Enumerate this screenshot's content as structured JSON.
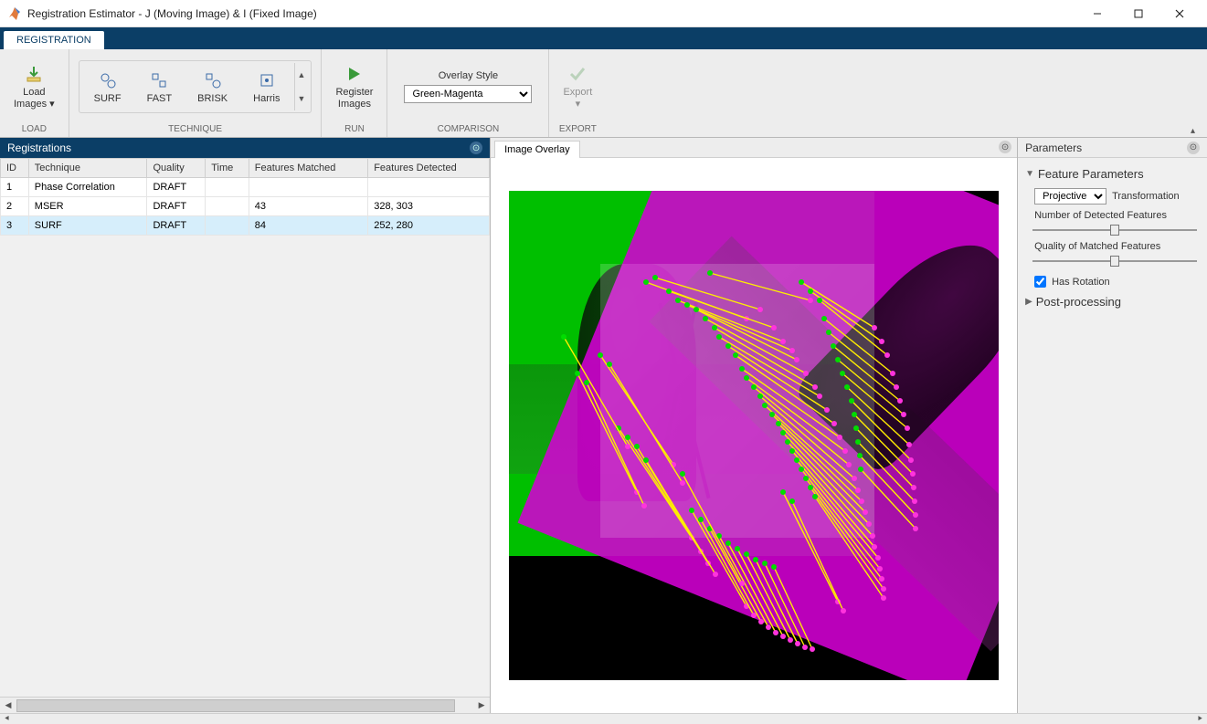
{
  "window": {
    "title": "Registration Estimator - J (Moving Image) & I (Fixed Image)"
  },
  "ribbon_tab": "REGISTRATION",
  "toolstrip": {
    "load": {
      "label": "Load\nImages",
      "group": "LOAD"
    },
    "technique": {
      "group": "TECHNIQUE",
      "items": [
        "SURF",
        "FAST",
        "BRISK",
        "Harris"
      ]
    },
    "run": {
      "label": "Register\nImages",
      "group": "RUN"
    },
    "comparison": {
      "caption": "Overlay Style",
      "value": "Green-Magenta",
      "group": "COMPARISON"
    },
    "export": {
      "label": "Export",
      "group": "EXPORT"
    }
  },
  "registrations": {
    "title": "Registrations",
    "columns": [
      "ID",
      "Technique",
      "Quality",
      "Time",
      "Features Matched",
      "Features Detected"
    ],
    "rows": [
      {
        "id": "1",
        "technique": "Phase Correlation",
        "quality": "DRAFT",
        "time": "",
        "matched": "",
        "detected": ""
      },
      {
        "id": "2",
        "technique": "MSER",
        "quality": "DRAFT",
        "time": "",
        "matched": "43",
        "detected": "328, 303"
      },
      {
        "id": "3",
        "technique": "SURF",
        "quality": "DRAFT",
        "time": "",
        "matched": "84",
        "detected": "252, 280"
      }
    ],
    "selected_index": 2
  },
  "overlay_tab": "Image Overlay",
  "parameters": {
    "title": "Parameters",
    "section_feature": "Feature Parameters",
    "transformation_label": "Transformation",
    "transformation_value": "Projective",
    "detected_label": "Number of Detected Features",
    "detected_pos_percent": 50,
    "matched_label": "Quality of Matched Features",
    "matched_pos_percent": 50,
    "has_rotation_label": "Has Rotation",
    "has_rotation_checked": true,
    "section_post": "Post-processing"
  },
  "match_lines": [
    [
      150,
      100,
      260,
      140
    ],
    [
      160,
      95,
      275,
      130
    ],
    [
      175,
      110,
      290,
      150
    ],
    [
      185,
      120,
      300,
      165
    ],
    [
      195,
      125,
      310,
      175
    ],
    [
      205,
      130,
      315,
      185
    ],
    [
      215,
      140,
      325,
      200
    ],
    [
      225,
      150,
      335,
      215
    ],
    [
      230,
      160,
      340,
      225
    ],
    [
      240,
      170,
      348,
      240
    ],
    [
      248,
      180,
      356,
      255
    ],
    [
      255,
      195,
      362,
      270
    ],
    [
      260,
      205,
      368,
      285
    ],
    [
      268,
      215,
      372,
      300
    ],
    [
      275,
      225,
      378,
      315
    ],
    [
      280,
      235,
      382,
      328
    ],
    [
      288,
      245,
      386,
      340
    ],
    [
      295,
      255,
      390,
      352
    ],
    [
      300,
      265,
      394,
      365
    ],
    [
      305,
      275,
      398,
      378
    ],
    [
      310,
      285,
      400,
      390
    ],
    [
      315,
      295,
      404,
      402
    ],
    [
      320,
      305,
      406,
      414
    ],
    [
      325,
      315,
      408,
      425
    ],
    [
      330,
      325,
      410,
      436
    ],
    [
      335,
      335,
      410,
      446
    ],
    [
      100,
      180,
      180,
      300
    ],
    [
      110,
      190,
      190,
      320
    ],
    [
      320,
      100,
      400,
      150
    ],
    [
      330,
      110,
      408,
      165
    ],
    [
      340,
      120,
      414,
      180
    ],
    [
      120,
      260,
      200,
      380
    ],
    [
      130,
      270,
      210,
      395
    ],
    [
      140,
      280,
      218,
      408
    ],
    [
      150,
      295,
      226,
      420
    ],
    [
      345,
      140,
      420,
      200
    ],
    [
      350,
      155,
      424,
      215
    ],
    [
      355,
      170,
      428,
      230
    ],
    [
      360,
      185,
      432,
      245
    ],
    [
      365,
      200,
      436,
      260
    ],
    [
      370,
      215,
      438,
      278
    ],
    [
      375,
      230,
      440,
      295
    ],
    [
      378,
      245,
      442,
      310
    ],
    [
      380,
      260,
      443,
      325
    ],
    [
      382,
      275,
      444,
      340
    ],
    [
      384,
      290,
      445,
      355
    ],
    [
      385,
      305,
      445,
      370
    ],
    [
      200,
      350,
      260,
      455
    ],
    [
      210,
      360,
      268,
      465
    ],
    [
      220,
      370,
      276,
      472
    ],
    [
      230,
      378,
      284,
      478
    ],
    [
      240,
      386,
      292,
      484
    ],
    [
      250,
      392,
      300,
      488
    ],
    [
      260,
      398,
      308,
      492
    ],
    [
      270,
      404,
      316,
      496
    ],
    [
      280,
      408,
      324,
      500
    ],
    [
      290,
      412,
      332,
      502
    ],
    [
      220,
      90,
      330,
      120
    ],
    [
      60,
      160,
      130,
      280
    ],
    [
      190,
      310,
      255,
      430
    ],
    [
      300,
      330,
      360,
      450
    ],
    [
      310,
      340,
      366,
      460
    ],
    [
      75,
      200,
      140,
      330
    ],
    [
      85,
      210,
      148,
      345
    ]
  ]
}
